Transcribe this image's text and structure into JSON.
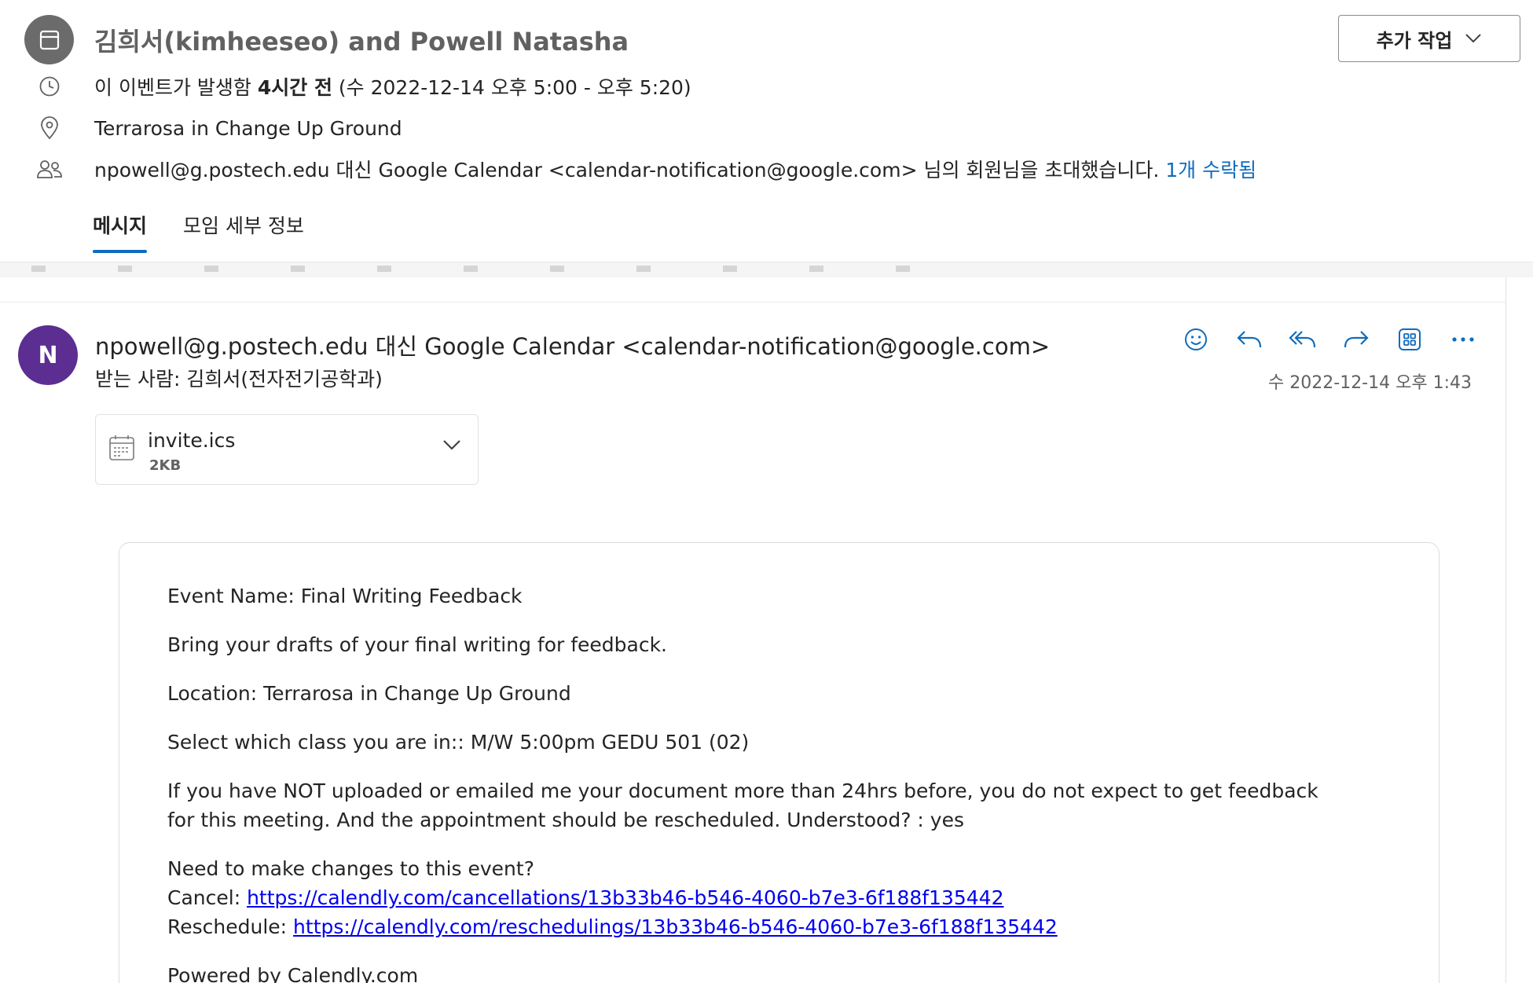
{
  "header": {
    "title": "김희서(kimheeseo) and Powell Natasha",
    "more_actions_label": "추가 작업",
    "time_prefix": "이 이벤트가 발생함 ",
    "time_relative": "4시간 전",
    "time_range": " (수 2022-12-14 오후 5:00 - 오후 5:20)",
    "location": "Terrarosa in Change Up Ground",
    "organizer_text": "npowell@g.postech.edu 대신 Google Calendar <calendar-notification@google.com> 님의 회원님을 초대했습니다. ",
    "accepted_label": "1개 수락됨"
  },
  "tabs": [
    {
      "label": "메시지"
    },
    {
      "label": "모임 세부 정보"
    }
  ],
  "message": {
    "avatar_initial": "N",
    "sender": "npowell@g.postech.edu 대신 Google Calendar <calendar-notification@google.com>",
    "recipients": "받는 사람:  김희서(전자전기공학과)",
    "date": "수 2022-12-14 오후 1:43",
    "attachment": {
      "name": "invite.ics",
      "size": "2KB"
    },
    "actions": [
      "emoji-icon",
      "reply-icon",
      "reply-all-icon",
      "forward-icon",
      "apps-icon",
      "more-icon"
    ]
  },
  "body": {
    "event_name": "Event Name: Final Writing Feedback",
    "description": "Bring your drafts of your final writing for feedback.",
    "location": "Location: Terrarosa in Change Up Ground",
    "class_line": "Select which class you are in:: M/W 5:00pm GEDU 501 (02)",
    "notice_line1": "If you have NOT uploaded or emailed me your document more than 24hrs before, you do not expect to get feedback",
    "notice_line2": "for this meeting. And the appointment should be rescheduled. Understood? : yes",
    "changes_heading": "Need to make changes to this event?",
    "cancel_label": "Cancel: ",
    "cancel_url": "https://calendly.com/cancellations/13b33b46-b546-4060-b7e3-6f188f135442",
    "reschedule_label": "Reschedule: ",
    "reschedule_url": "https://calendly.com/reschedulings/13b33b46-b546-4060-b7e3-6f188f135442",
    "powered_by": "Powered by Calendly.com"
  },
  "colors": {
    "accent": "#0f6cbd",
    "avatar": "#5c2e91",
    "link": "#0000ee",
    "title": "#616161"
  }
}
